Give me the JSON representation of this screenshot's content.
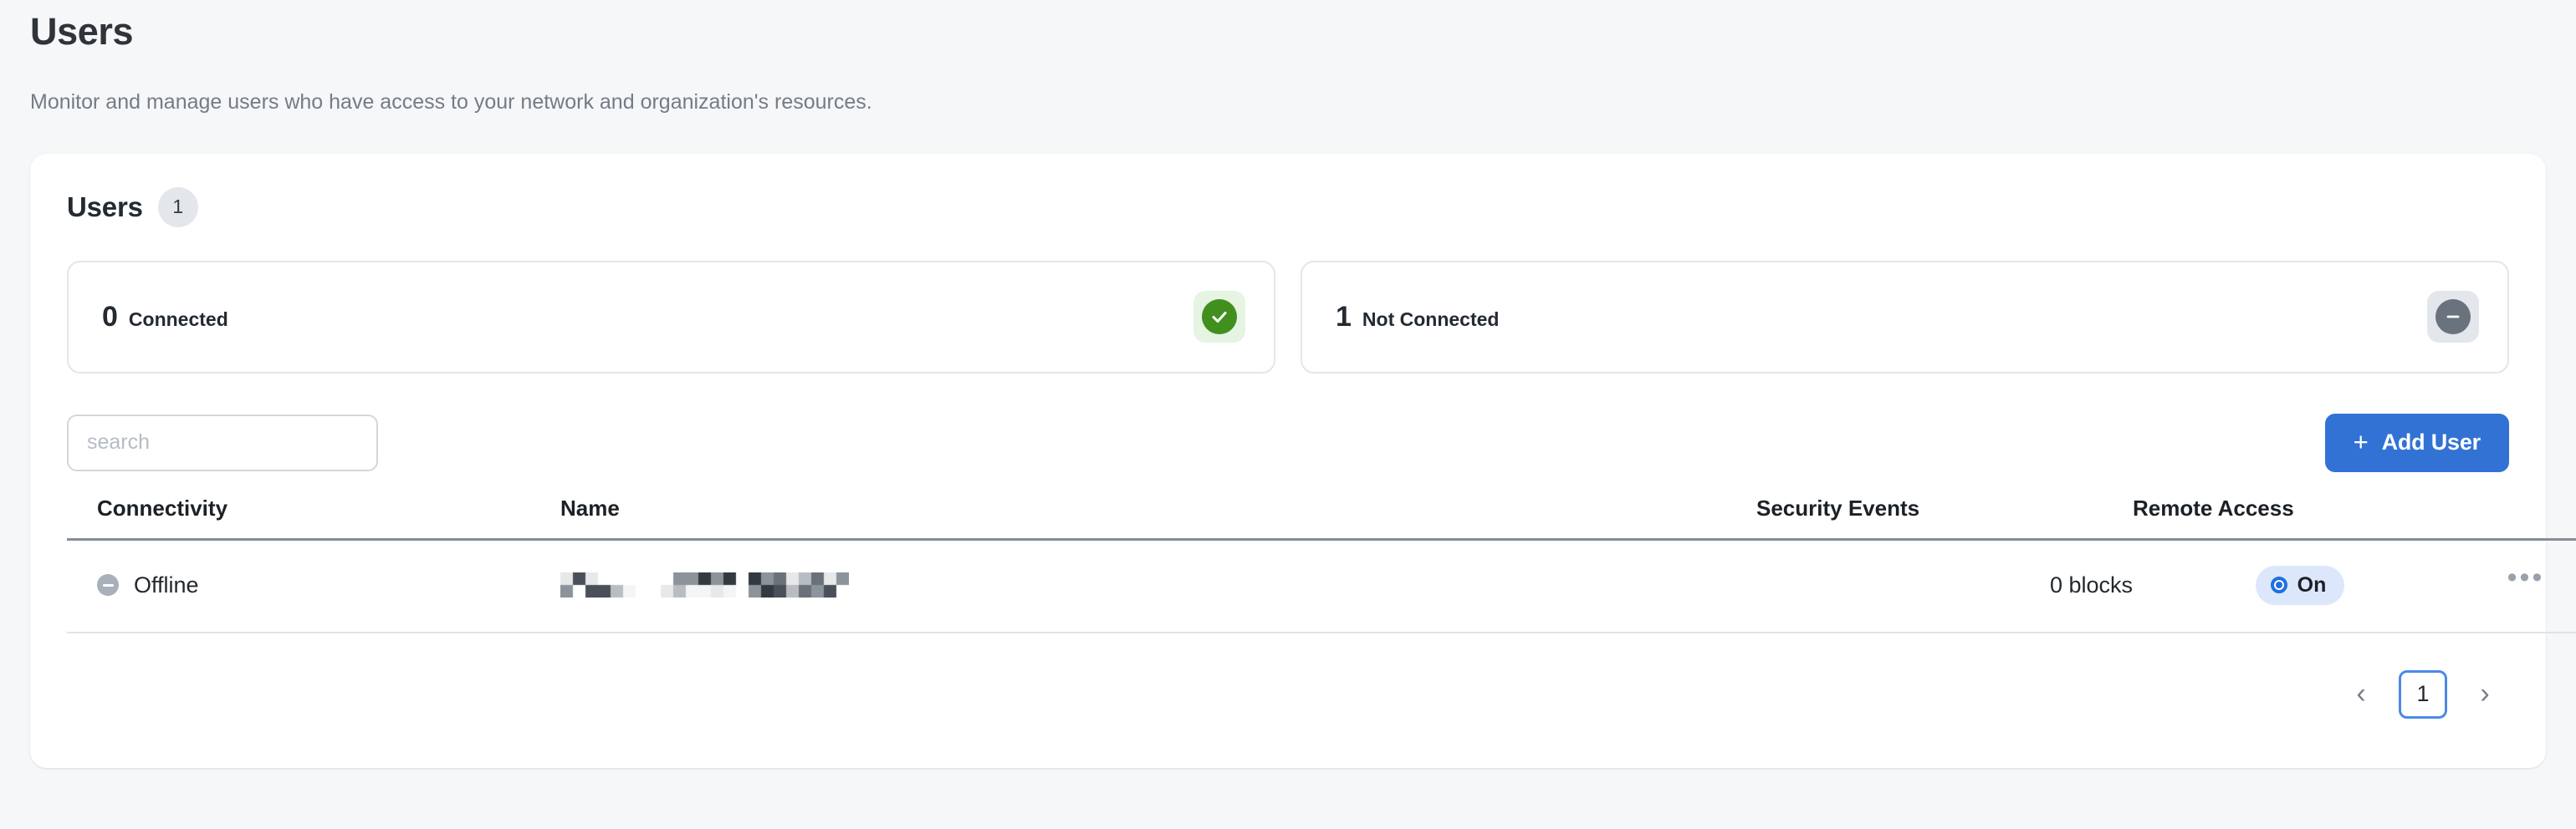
{
  "header": {
    "title": "Users",
    "subtitle": "Monitor and manage users who have access to your network and organization's resources."
  },
  "card": {
    "title": "Users",
    "count_badge": "1"
  },
  "stats": [
    {
      "number": "0",
      "label": "Connected",
      "icon": "check-circle-icon",
      "icon_color": "#41901f",
      "icon_bg": "#e6f4e2"
    },
    {
      "number": "1",
      "label": "Not Connected",
      "icon": "minus-circle-icon",
      "icon_color": "#6a727e",
      "icon_bg": "#e3e7eb"
    }
  ],
  "toolbar": {
    "search_placeholder": "search",
    "search_value": "",
    "add_user_label": "Add User",
    "add_user_plus": "+",
    "accent_color": "#3272d4"
  },
  "table": {
    "columns": [
      "Connectivity",
      "Name",
      "Security Events",
      "Remote Access"
    ],
    "rows": [
      {
        "connectivity": "Offline",
        "connectivity_icon": "minus-circle-icon",
        "name": "",
        "name_redacted": true,
        "security_events": "0 blocks",
        "remote_access": "On",
        "remote_access_icon": "radio-on-icon",
        "actions_icon": "ellipsis-icon",
        "actions_label": "•••"
      }
    ]
  },
  "pagination": {
    "prev": "‹",
    "next": "›",
    "current_page": "1"
  }
}
